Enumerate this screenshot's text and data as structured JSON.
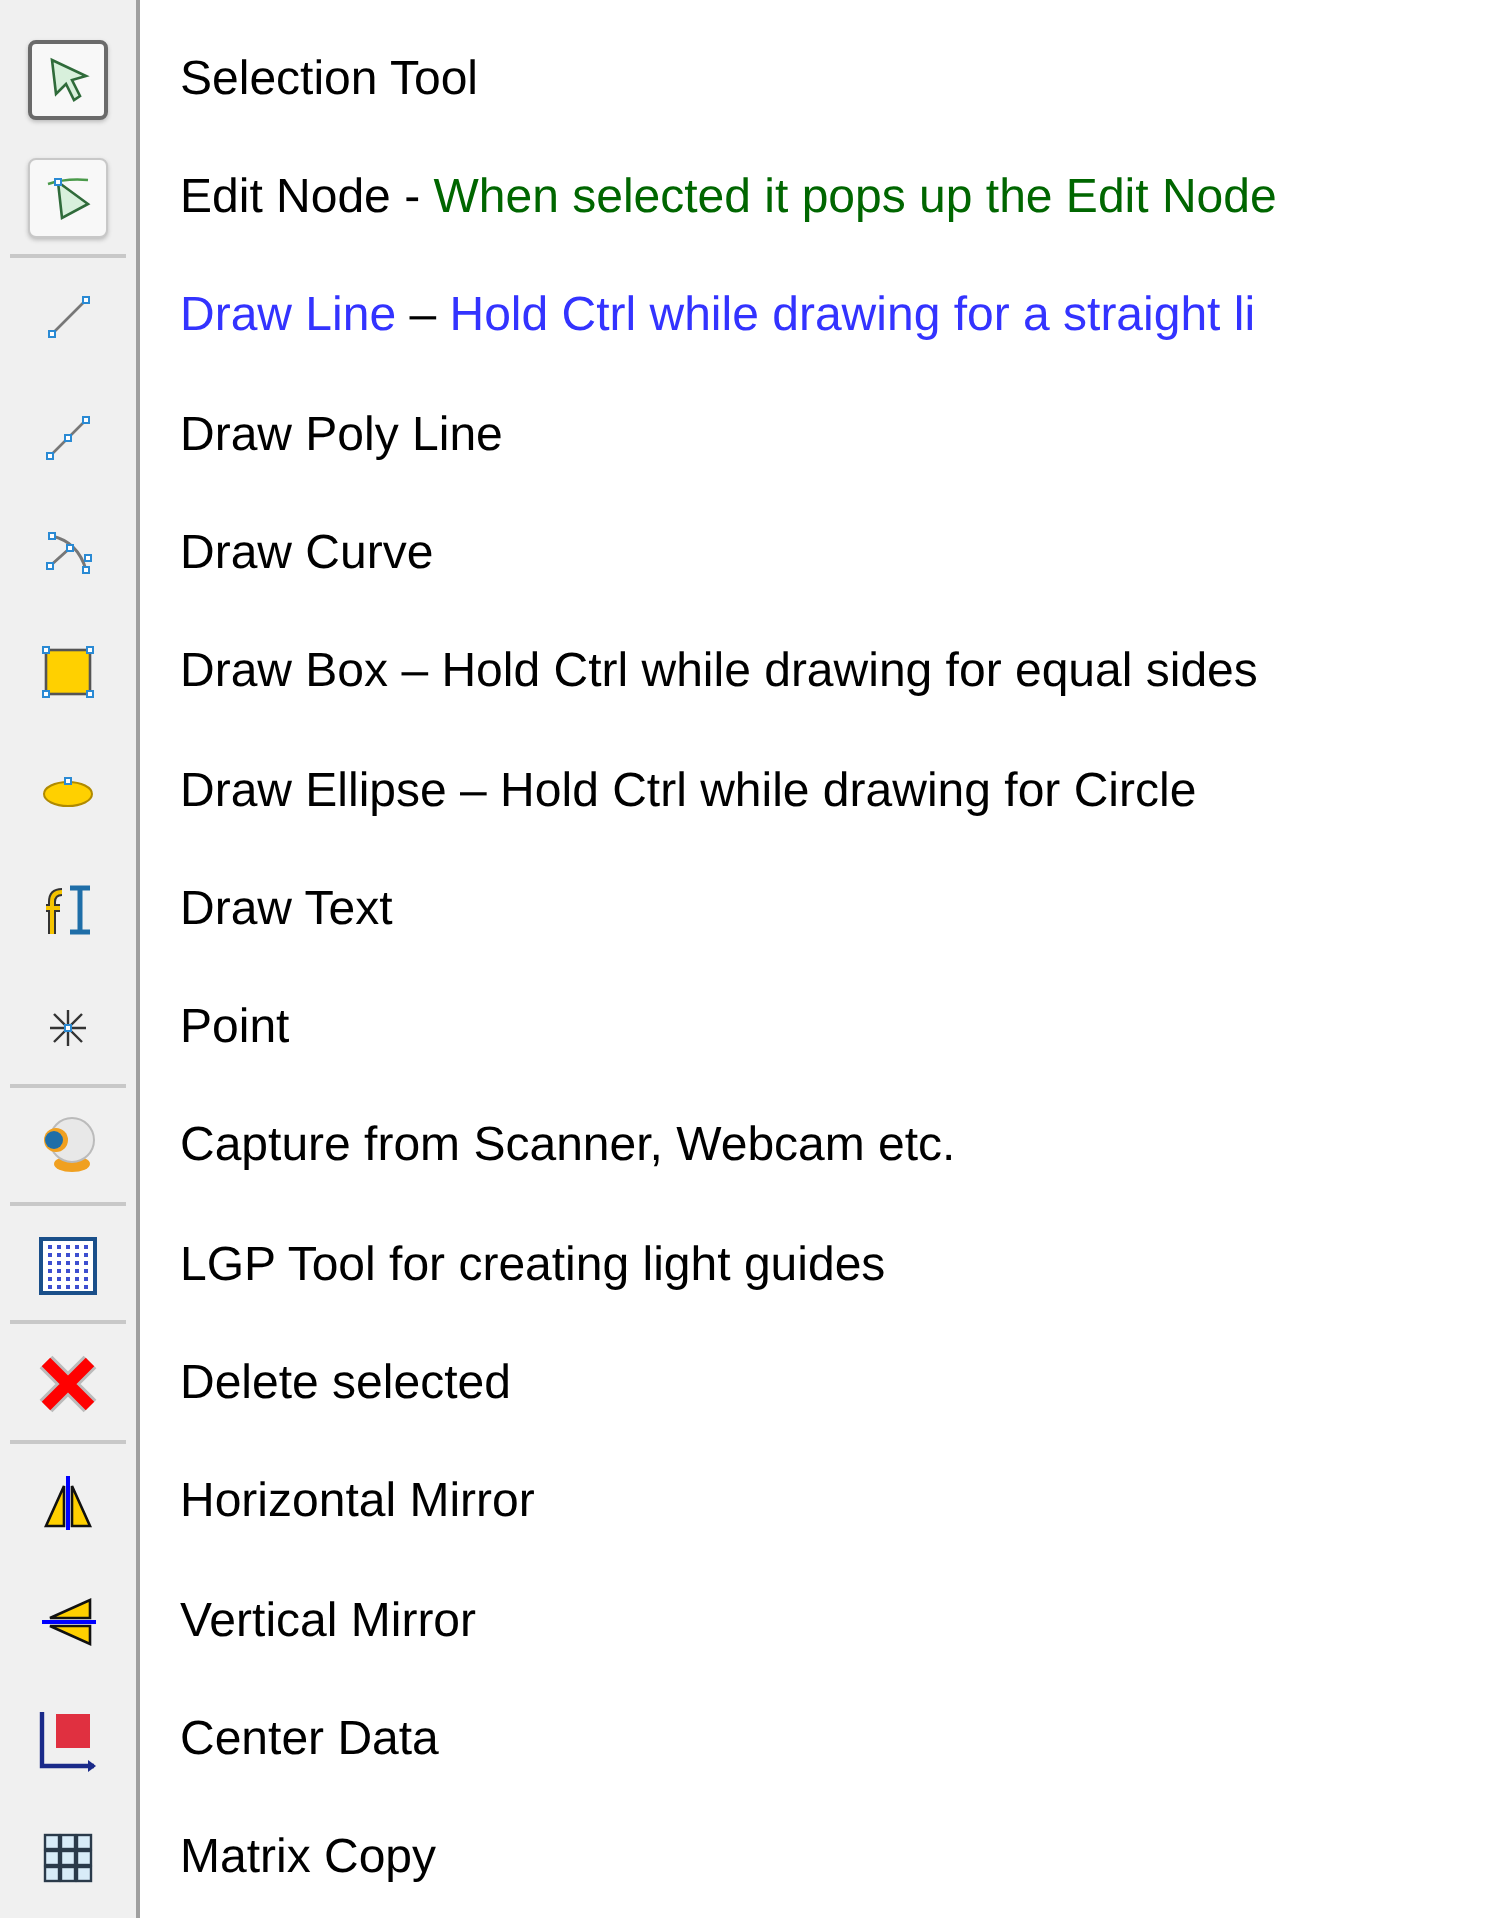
{
  "tools": [
    {
      "kind": "arrow",
      "selected": true,
      "pressed": true,
      "separator_after": false,
      "text": [
        {
          "s": "Selection Tool",
          "color": "#000000"
        }
      ]
    },
    {
      "kind": "node",
      "selected": false,
      "pressed": true,
      "separator_after": true,
      "text": [
        {
          "s": "Edit Node - ",
          "color": "#000000"
        },
        {
          "s": "When selected it pops up the Edit Node",
          "color": "#006600"
        }
      ]
    },
    {
      "kind": "line",
      "selected": false,
      "pressed": false,
      "separator_after": false,
      "text": [
        {
          "s": "Draw Line",
          "color": "#3333ff"
        },
        {
          "s": " – ",
          "color": "#000000"
        },
        {
          "s": "Hold Ctrl while drawing for a straight li",
          "color": "#3333ff"
        }
      ]
    },
    {
      "kind": "polyline",
      "selected": false,
      "pressed": false,
      "separator_after": false,
      "text": [
        {
          "s": "Draw Poly Line",
          "color": "#000000"
        }
      ]
    },
    {
      "kind": "curve",
      "selected": false,
      "pressed": false,
      "separator_after": false,
      "text": [
        {
          "s": "Draw Curve",
          "color": "#000000"
        }
      ]
    },
    {
      "kind": "box",
      "selected": false,
      "pressed": false,
      "separator_after": false,
      "text": [
        {
          "s": "Draw Box – Hold Ctrl while drawing for equal sides",
          "color": "#000000"
        }
      ]
    },
    {
      "kind": "ellipse",
      "selected": false,
      "pressed": false,
      "separator_after": false,
      "text": [
        {
          "s": "Draw Ellipse – Hold Ctrl while drawing for Circle",
          "color": "#000000"
        }
      ]
    },
    {
      "kind": "text",
      "selected": false,
      "pressed": false,
      "separator_after": false,
      "text": [
        {
          "s": "Draw Text",
          "color": "#000000"
        }
      ]
    },
    {
      "kind": "point",
      "selected": false,
      "pressed": false,
      "separator_after": true,
      "text": [
        {
          "s": "Point",
          "color": "#000000"
        }
      ]
    },
    {
      "kind": "webcam",
      "selected": false,
      "pressed": false,
      "separator_after": true,
      "text": [
        {
          "s": "Capture from Scanner, Webcam etc.",
          "color": "#000000"
        }
      ]
    },
    {
      "kind": "grid",
      "selected": false,
      "pressed": false,
      "separator_after": true,
      "text": [
        {
          "s": "LGP Tool for creating light guides",
          "color": "#000000"
        }
      ]
    },
    {
      "kind": "delete",
      "selected": false,
      "pressed": false,
      "separator_after": true,
      "text": [
        {
          "s": "Delete selected",
          "color": "#000000"
        }
      ]
    },
    {
      "kind": "hmirror",
      "selected": false,
      "pressed": false,
      "separator_after": false,
      "text": [
        {
          "s": "Horizontal Mirror",
          "color": "#000000"
        }
      ]
    },
    {
      "kind": "vmirror",
      "selected": false,
      "pressed": false,
      "separator_after": false,
      "text": [
        {
          "s": "Vertical Mirror",
          "color": "#000000"
        }
      ]
    },
    {
      "kind": "center",
      "selected": false,
      "pressed": false,
      "separator_after": false,
      "text": [
        {
          "s": "Center Data",
          "color": "#000000"
        }
      ]
    },
    {
      "kind": "matrix",
      "selected": false,
      "pressed": false,
      "separator_after": false,
      "text": [
        {
          "s": "Matrix Copy",
          "color": "#000000"
        }
      ]
    }
  ]
}
